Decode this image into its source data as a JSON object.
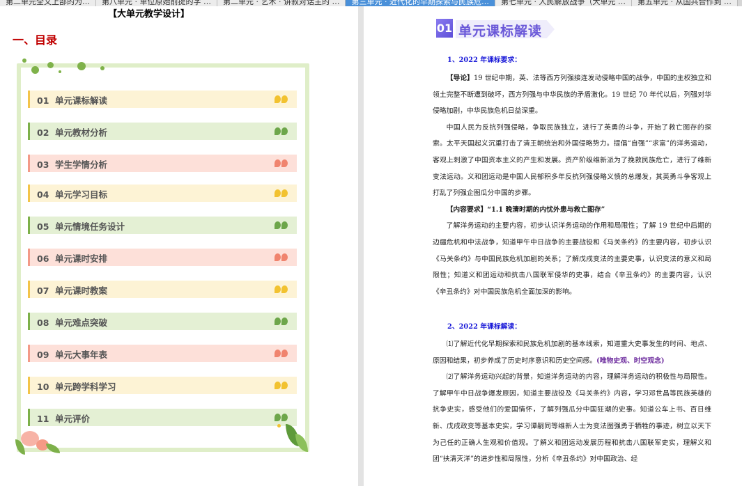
{
  "tabs": [
    {
      "label": "第二单元全文上部的为…",
      "active": false
    },
    {
      "label": "第八单元 · 单位原始前提的字 …",
      "active": false
    },
    {
      "label": "第二单元 · 艺术 · 讲叙对话主的 …",
      "active": false
    },
    {
      "label": "第三单元 · 近代化的早期探索与民族危…",
      "active": true
    },
    {
      "label": "第七单元 · 人民解放战争（大单元 …",
      "active": false
    },
    {
      "label": "第五单元 · 从国共合作到 …",
      "active": false
    }
  ],
  "left_page": {
    "doc_title": "【大单元教学设计】",
    "section_title": "一、目录",
    "toc": [
      {
        "num": "01",
        "label": "单元课标解读",
        "color": "y"
      },
      {
        "num": "02",
        "label": "单元教材分析",
        "color": "g"
      },
      {
        "num": "03",
        "label": "学生学情分析",
        "color": "p"
      },
      {
        "num": "04",
        "label": "单元学习目标",
        "color": "y"
      },
      {
        "num": "05",
        "label": "单元情境任务设计",
        "color": "g"
      },
      {
        "num": "06",
        "label": "单元课时安排",
        "color": "p"
      },
      {
        "num": "07",
        "label": "单元课时教案",
        "color": "y"
      },
      {
        "num": "08",
        "label": "单元难点突破",
        "color": "g"
      },
      {
        "num": "09",
        "label": "单元大事年表",
        "color": "p"
      },
      {
        "num": "10",
        "label": "单元跨学科学习",
        "color": "y"
      },
      {
        "num": "11",
        "label": "单元评价",
        "color": "g"
      }
    ]
  },
  "right_page": {
    "banner_num": "01",
    "banner_title": "单元课标解读",
    "heading1": "1、2022 年课标要求：",
    "intro_label": "【导论】",
    "intro_text": "19 世纪中期，英、法等西方列强接连发动侵略中国的战争，中国的主权独立和领土完整不断遭到破坏，西方列强与中华民族的矛盾激化。19 世纪 70 年代以后，列强对华侵略加剧，中华民族危机日益深重。",
    "para2": "中国人民为反抗列强侵略，争取民族独立，进行了英勇的斗争，开始了救亡图存的探索。太平天国起义沉重打击了清王朝统治和外国侵略势力。提倡“自强”“求富”的洋务运动，客观上刺激了中国资本主义的产生和发展。资产阶级维新派为了挽救民族危亡，进行了维新变法运动。义和团运动是中国人民郁积多年反抗列强侵略义愤的总爆发，其英勇斗争客观上打乱了列强企图瓜分中国的步骤。",
    "req_label": "【内容要求】“1.1 晚清时期的内忧外患与救亡图存”",
    "para3": "了解洋务运动的主要内容，初步认识洋务运动的作用和局限性；了解 19 世纪中后期的边疆危机和中法战争，知道甲午中日战争的主要战役和《马关条约》的主要内容，初步认识《马关条约》与中国民族危机加剧的关系；了解戊戌变法的主要史事，认识变法的意义和局限性；知道义和团运动和抗击八国联军侵华的史事，结合《辛丑条约》的主要内容，认识《辛丑条约》对中国民族危机全面加深的影响。",
    "heading2": "2、2022 年课标解读：",
    "para4": "⑴了解近代化早期探索和民族危机加剧的基本线索，知道重大史事发生的时间、地点、原因和结果，初步养成了历史时序意识和历史空间感。",
    "para4_tag": "(唯物史观、时空观念)",
    "para5": "⑵了解洋务运动兴起的背景，知道洋务运动的内容，理解洋务运动的积极性与局限性。了解甲午中日战争爆发原因，知道主要战役及《马关条约》内容，学习邓世昌等民族英雄的抗争史实，感受他们的爱国情怀，了解列强瓜分中国狂潮的史事。知道公车上书、百日维新、戊戌政变等基本史实，学习谭嗣同等维新人士为变法图强勇于牺牲的事迹，树立以天下为己任的正确人生观和价值观。了解义和团运动发展历程和抗击八国联军史实，理解义和团“扶清灭洋”的进步性和局限性，分析《辛丑条约》对中国政治、经"
  }
}
